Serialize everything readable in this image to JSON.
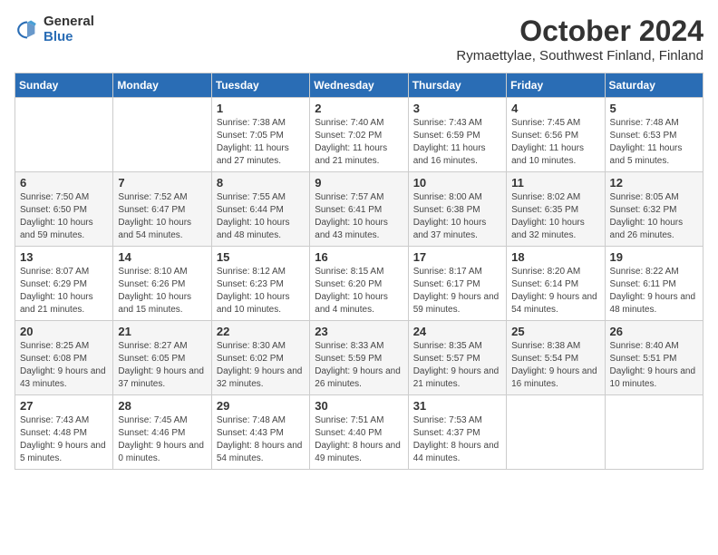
{
  "logo": {
    "general": "General",
    "blue": "Blue"
  },
  "title": "October 2024",
  "subtitle": "Rymaettylae, Southwest Finland, Finland",
  "days_of_week": [
    "Sunday",
    "Monday",
    "Tuesday",
    "Wednesday",
    "Thursday",
    "Friday",
    "Saturday"
  ],
  "weeks": [
    [
      {
        "day": "",
        "sunrise": "",
        "sunset": "",
        "daylight": ""
      },
      {
        "day": "",
        "sunrise": "",
        "sunset": "",
        "daylight": ""
      },
      {
        "day": "1",
        "sunrise": "Sunrise: 7:38 AM",
        "sunset": "Sunset: 7:05 PM",
        "daylight": "Daylight: 11 hours and 27 minutes."
      },
      {
        "day": "2",
        "sunrise": "Sunrise: 7:40 AM",
        "sunset": "Sunset: 7:02 PM",
        "daylight": "Daylight: 11 hours and 21 minutes."
      },
      {
        "day": "3",
        "sunrise": "Sunrise: 7:43 AM",
        "sunset": "Sunset: 6:59 PM",
        "daylight": "Daylight: 11 hours and 16 minutes."
      },
      {
        "day": "4",
        "sunrise": "Sunrise: 7:45 AM",
        "sunset": "Sunset: 6:56 PM",
        "daylight": "Daylight: 11 hours and 10 minutes."
      },
      {
        "day": "5",
        "sunrise": "Sunrise: 7:48 AM",
        "sunset": "Sunset: 6:53 PM",
        "daylight": "Daylight: 11 hours and 5 minutes."
      }
    ],
    [
      {
        "day": "6",
        "sunrise": "Sunrise: 7:50 AM",
        "sunset": "Sunset: 6:50 PM",
        "daylight": "Daylight: 10 hours and 59 minutes."
      },
      {
        "day": "7",
        "sunrise": "Sunrise: 7:52 AM",
        "sunset": "Sunset: 6:47 PM",
        "daylight": "Daylight: 10 hours and 54 minutes."
      },
      {
        "day": "8",
        "sunrise": "Sunrise: 7:55 AM",
        "sunset": "Sunset: 6:44 PM",
        "daylight": "Daylight: 10 hours and 48 minutes."
      },
      {
        "day": "9",
        "sunrise": "Sunrise: 7:57 AM",
        "sunset": "Sunset: 6:41 PM",
        "daylight": "Daylight: 10 hours and 43 minutes."
      },
      {
        "day": "10",
        "sunrise": "Sunrise: 8:00 AM",
        "sunset": "Sunset: 6:38 PM",
        "daylight": "Daylight: 10 hours and 37 minutes."
      },
      {
        "day": "11",
        "sunrise": "Sunrise: 8:02 AM",
        "sunset": "Sunset: 6:35 PM",
        "daylight": "Daylight: 10 hours and 32 minutes."
      },
      {
        "day": "12",
        "sunrise": "Sunrise: 8:05 AM",
        "sunset": "Sunset: 6:32 PM",
        "daylight": "Daylight: 10 hours and 26 minutes."
      }
    ],
    [
      {
        "day": "13",
        "sunrise": "Sunrise: 8:07 AM",
        "sunset": "Sunset: 6:29 PM",
        "daylight": "Daylight: 10 hours and 21 minutes."
      },
      {
        "day": "14",
        "sunrise": "Sunrise: 8:10 AM",
        "sunset": "Sunset: 6:26 PM",
        "daylight": "Daylight: 10 hours and 15 minutes."
      },
      {
        "day": "15",
        "sunrise": "Sunrise: 8:12 AM",
        "sunset": "Sunset: 6:23 PM",
        "daylight": "Daylight: 10 hours and 10 minutes."
      },
      {
        "day": "16",
        "sunrise": "Sunrise: 8:15 AM",
        "sunset": "Sunset: 6:20 PM",
        "daylight": "Daylight: 10 hours and 4 minutes."
      },
      {
        "day": "17",
        "sunrise": "Sunrise: 8:17 AM",
        "sunset": "Sunset: 6:17 PM",
        "daylight": "Daylight: 9 hours and 59 minutes."
      },
      {
        "day": "18",
        "sunrise": "Sunrise: 8:20 AM",
        "sunset": "Sunset: 6:14 PM",
        "daylight": "Daylight: 9 hours and 54 minutes."
      },
      {
        "day": "19",
        "sunrise": "Sunrise: 8:22 AM",
        "sunset": "Sunset: 6:11 PM",
        "daylight": "Daylight: 9 hours and 48 minutes."
      }
    ],
    [
      {
        "day": "20",
        "sunrise": "Sunrise: 8:25 AM",
        "sunset": "Sunset: 6:08 PM",
        "daylight": "Daylight: 9 hours and 43 minutes."
      },
      {
        "day": "21",
        "sunrise": "Sunrise: 8:27 AM",
        "sunset": "Sunset: 6:05 PM",
        "daylight": "Daylight: 9 hours and 37 minutes."
      },
      {
        "day": "22",
        "sunrise": "Sunrise: 8:30 AM",
        "sunset": "Sunset: 6:02 PM",
        "daylight": "Daylight: 9 hours and 32 minutes."
      },
      {
        "day": "23",
        "sunrise": "Sunrise: 8:33 AM",
        "sunset": "Sunset: 5:59 PM",
        "daylight": "Daylight: 9 hours and 26 minutes."
      },
      {
        "day": "24",
        "sunrise": "Sunrise: 8:35 AM",
        "sunset": "Sunset: 5:57 PM",
        "daylight": "Daylight: 9 hours and 21 minutes."
      },
      {
        "day": "25",
        "sunrise": "Sunrise: 8:38 AM",
        "sunset": "Sunset: 5:54 PM",
        "daylight": "Daylight: 9 hours and 16 minutes."
      },
      {
        "day": "26",
        "sunrise": "Sunrise: 8:40 AM",
        "sunset": "Sunset: 5:51 PM",
        "daylight": "Daylight: 9 hours and 10 minutes."
      }
    ],
    [
      {
        "day": "27",
        "sunrise": "Sunrise: 7:43 AM",
        "sunset": "Sunset: 4:48 PM",
        "daylight": "Daylight: 9 hours and 5 minutes."
      },
      {
        "day": "28",
        "sunrise": "Sunrise: 7:45 AM",
        "sunset": "Sunset: 4:46 PM",
        "daylight": "Daylight: 9 hours and 0 minutes."
      },
      {
        "day": "29",
        "sunrise": "Sunrise: 7:48 AM",
        "sunset": "Sunset: 4:43 PM",
        "daylight": "Daylight: 8 hours and 54 minutes."
      },
      {
        "day": "30",
        "sunrise": "Sunrise: 7:51 AM",
        "sunset": "Sunset: 4:40 PM",
        "daylight": "Daylight: 8 hours and 49 minutes."
      },
      {
        "day": "31",
        "sunrise": "Sunrise: 7:53 AM",
        "sunset": "Sunset: 4:37 PM",
        "daylight": "Daylight: 8 hours and 44 minutes."
      },
      {
        "day": "",
        "sunrise": "",
        "sunset": "",
        "daylight": ""
      },
      {
        "day": "",
        "sunrise": "",
        "sunset": "",
        "daylight": ""
      }
    ]
  ]
}
